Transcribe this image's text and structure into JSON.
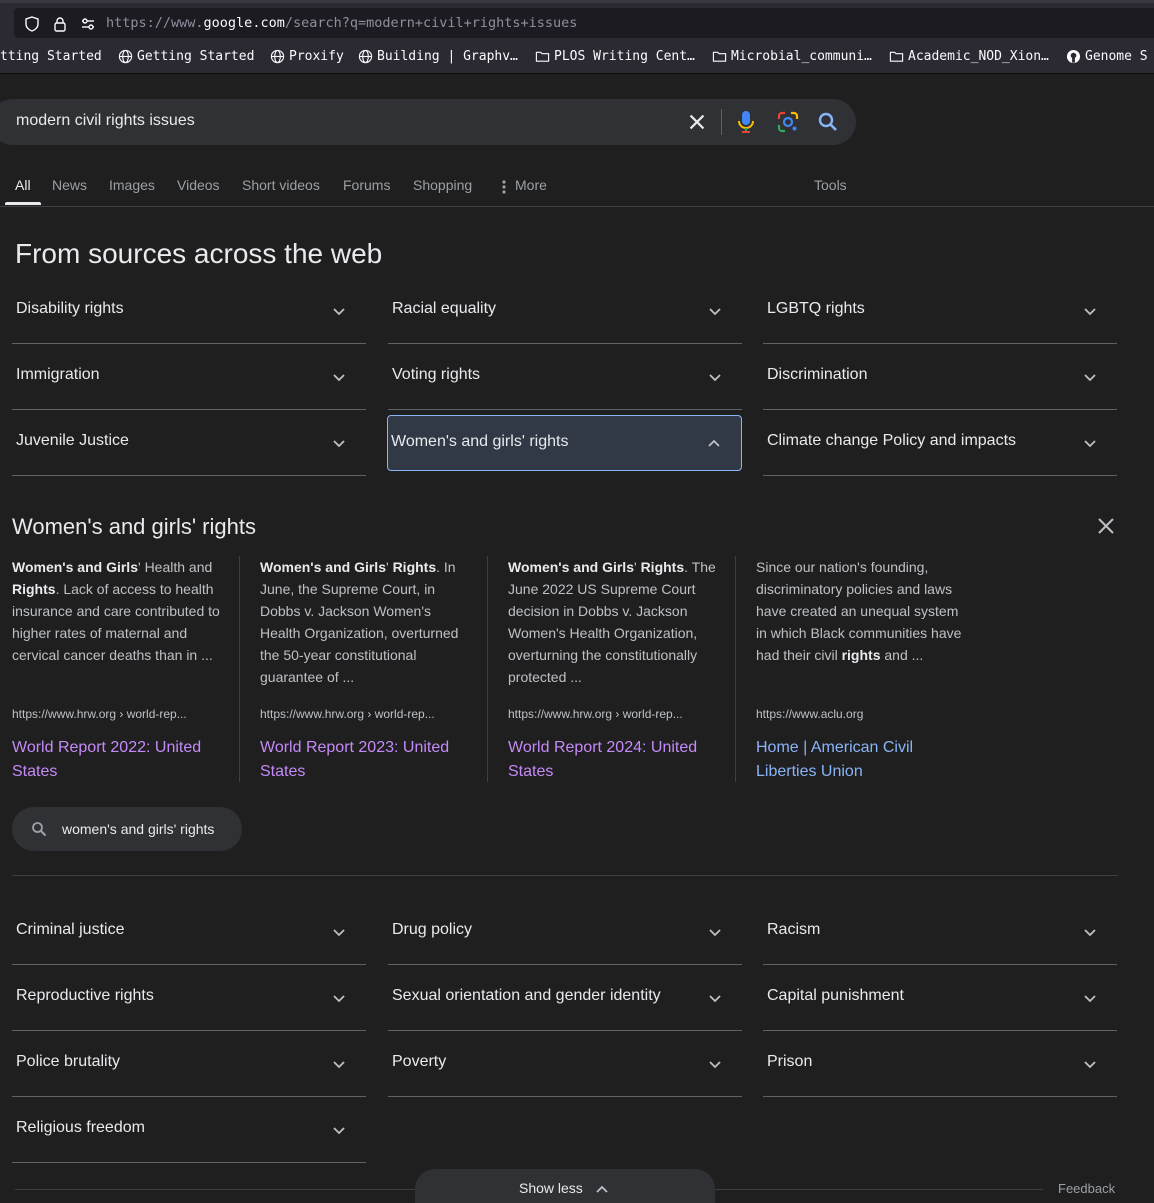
{
  "browser": {
    "url_prefix": "https://www.",
    "url_domain": "google.com",
    "url_rest": "/search?q=modern+civil+rights+issues",
    "bookmarks": [
      "tting Started",
      "Getting Started",
      "Proxify",
      "Building | Graphv…",
      "PLOS Writing Cent…",
      "Microbial_communi…",
      "Academic_NOD_Xion…",
      "Genome S"
    ]
  },
  "search": {
    "query": "modern civil rights issues"
  },
  "tabs": {
    "all": "All",
    "news": "News",
    "images": "Images",
    "videos": "Videos",
    "short_videos": "Short videos",
    "forums": "Forums",
    "shopping": "Shopping",
    "more": "More",
    "tools": "Tools"
  },
  "section": {
    "heading": "From sources across the web"
  },
  "topics_top": [
    "Disability rights",
    "Racial equality",
    "LGBTQ rights",
    "Immigration",
    "Voting rights",
    "Discrimination",
    "Juvenile Justice",
    "Women's and girls' rights",
    "Climate change Policy and impacts"
  ],
  "panel": {
    "title": "Women's and girls' rights",
    "cards": [
      {
        "snippet_html": "<b>Women's and Girls</b>' Health and <b>Rights</b>. Lack of access to health insurance and care contributed to higher rates of maternal and cervical cancer deaths than in ...",
        "source": "https://www.hrw.org › world-rep...",
        "title": "World Report 2022: United States"
      },
      {
        "snippet_html": "<b>Women's and Girls</b>' <b>Rights</b>. In June, the Supreme Court, in Dobbs v. Jackson Women's Health Organization, overturned the 50-year constitutional guarantee of ...",
        "source": "https://www.hrw.org › world-rep...",
        "title": "World Report 2023: United States"
      },
      {
        "snippet_html": "<b>Women's and Girls</b>' <b>Rights</b>. The June 2022 US Supreme Court decision in Dobbs v. Jackson Women's Health Organization, overturning the constitutionally protected ...",
        "source": "https://www.hrw.org › world-rep...",
        "title": "World Report 2024: United States"
      },
      {
        "snippet_html": "Since our nation's founding, discriminatory policies and laws have created an unequal system in which Black communities have had their civil <b>rights</b> and ...",
        "source": "https://www.aclu.org",
        "title": "Home | American Civil Liberties Union"
      }
    ],
    "chip": "women's and girls' rights"
  },
  "topics_bottom": [
    "Criminal justice",
    "Drug policy",
    "Racism",
    "Reproductive rights",
    "Sexual orientation and gender identity",
    "Capital punishment",
    "Police brutality",
    "Poverty",
    "Prison",
    "Religious freedom"
  ],
  "footer": {
    "show_less": "Show less",
    "feedback": "Feedback"
  },
  "colors": {
    "background": "#1f1f1f",
    "visited_link": "#c58af9",
    "link": "#8ab4f8",
    "active_border": "#8ab4f8"
  }
}
